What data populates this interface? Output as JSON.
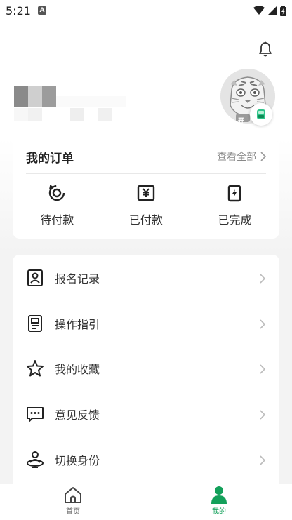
{
  "status_bar": {
    "time": "5:21",
    "notification_icon": "a-icon"
  },
  "header": {
    "bell_icon": "bell-icon"
  },
  "profile": {
    "avatar_badge_text": "开",
    "badge_icon": "scanner-icon"
  },
  "orders": {
    "title": "我的订单",
    "view_all": "查看全部",
    "items": [
      {
        "label": "待付款",
        "icon": "refresh-circle-icon"
      },
      {
        "label": "已付款",
        "icon": "yen-box-icon"
      },
      {
        "label": "已完成",
        "icon": "clipboard-bolt-icon"
      }
    ]
  },
  "menu": {
    "items": [
      {
        "label": "报名记录",
        "icon": "id-card-icon"
      },
      {
        "label": "操作指引",
        "icon": "document-icon"
      },
      {
        "label": "我的收藏",
        "icon": "star-icon"
      },
      {
        "label": "意见反馈",
        "icon": "message-icon"
      },
      {
        "label": "切换身份",
        "icon": "person-switch-icon"
      }
    ]
  },
  "bottom_nav": {
    "home_label": "首页",
    "mine_label": "我的"
  },
  "colors": {
    "accent": "#13a05a",
    "inactive": "#555555"
  }
}
